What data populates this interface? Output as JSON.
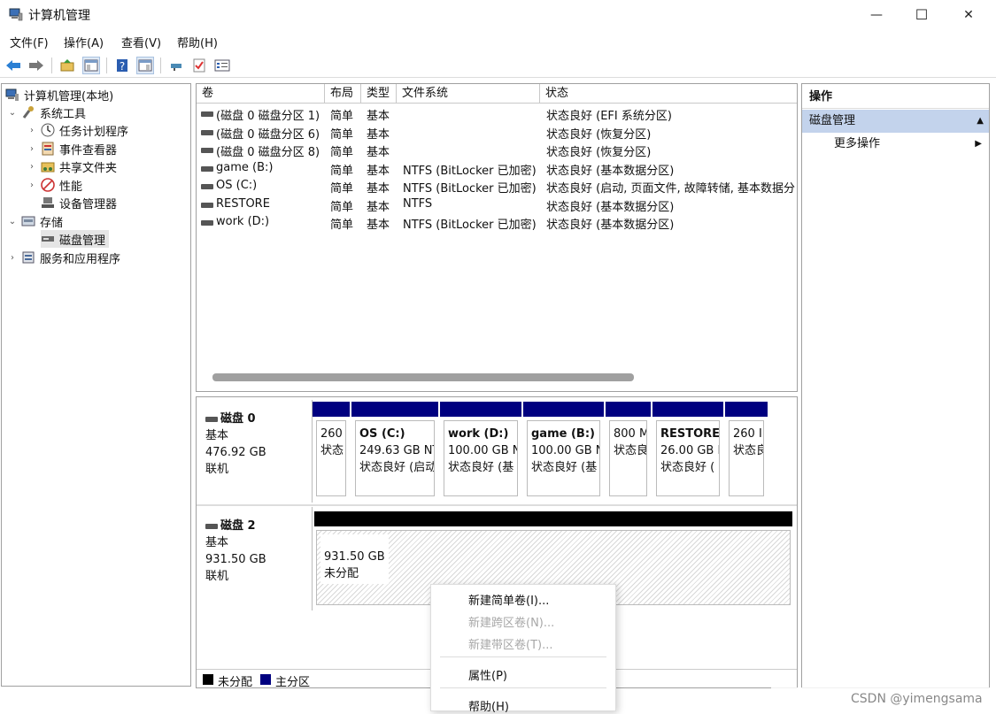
{
  "window": {
    "title": "计算机管理",
    "minimize_glyph": "—",
    "maximize_glyph": "☐",
    "close_glyph": "✕"
  },
  "menu": [
    "文件(F)",
    "操作(A)",
    "查看(V)",
    "帮助(H)"
  ],
  "tree": {
    "root": "计算机管理(本地)",
    "system_tools": "系统工具",
    "task_scheduler": "任务计划程序",
    "event_viewer": "事件查看器",
    "shared_folders": "共享文件夹",
    "performance": "性能",
    "device_manager": "设备管理器",
    "storage": "存储",
    "disk_management": "磁盘管理",
    "services_apps": "服务和应用程序"
  },
  "volume_table": {
    "columns": [
      "卷",
      "布局",
      "类型",
      "文件系统",
      "状态"
    ],
    "rows": [
      {
        "vol": "(磁盘 0 磁盘分区 1)",
        "layout": "简单",
        "type": "基本",
        "fs": "",
        "status": "状态良好 (EFI 系统分区)"
      },
      {
        "vol": "(磁盘 0 磁盘分区 6)",
        "layout": "简单",
        "type": "基本",
        "fs": "",
        "status": "状态良好 (恢复分区)"
      },
      {
        "vol": "(磁盘 0 磁盘分区 8)",
        "layout": "简单",
        "type": "基本",
        "fs": "",
        "status": "状态良好 (恢复分区)"
      },
      {
        "vol": "game (B:)",
        "layout": "简单",
        "type": "基本",
        "fs": "NTFS (BitLocker 已加密)",
        "status": "状态良好 (基本数据分区)"
      },
      {
        "vol": "OS (C:)",
        "layout": "简单",
        "type": "基本",
        "fs": "NTFS (BitLocker 已加密)",
        "status": "状态良好 (启动, 页面文件, 故障转储, 基本数据分"
      },
      {
        "vol": "RESTORE",
        "layout": "简单",
        "type": "基本",
        "fs": "NTFS",
        "status": "状态良好 (基本数据分区)"
      },
      {
        "vol": "work (D:)",
        "layout": "简单",
        "type": "基本",
        "fs": "NTFS (BitLocker 已加密)",
        "status": "状态良好 (基本数据分区)"
      }
    ]
  },
  "disks": [
    {
      "name": "磁盘 0",
      "type": "基本",
      "size": "476.92 GB",
      "state": "联机",
      "partitions": [
        {
          "label": "",
          "size": "260",
          "status": "状态"
        },
        {
          "label": "OS (C:)",
          "size": "249.63 GB NT",
          "status": "状态良好 (启动"
        },
        {
          "label": "work (D:)",
          "size": "100.00 GB N",
          "status": "状态良好 (基"
        },
        {
          "label": "game (B:)",
          "size": "100.00 GB N",
          "status": "状态良好 (基"
        },
        {
          "label": "",
          "size": "800 M",
          "status": "状态良"
        },
        {
          "label": "RESTORE",
          "size": "26.00 GB I",
          "status": "状态良好 ("
        },
        {
          "label": "",
          "size": "260 I",
          "status": "状态良"
        }
      ]
    },
    {
      "name": "磁盘 2",
      "type": "基本",
      "size": "931.50 GB",
      "state": "联机",
      "unallocated": {
        "size": "931.50 GB",
        "status": "未分配"
      }
    }
  ],
  "legend": {
    "unallocated": "未分配",
    "primary": "主分区"
  },
  "actions": {
    "header": "操作",
    "section": "磁盘管理",
    "more": "更多操作"
  },
  "context_menu": {
    "new_simple": "新建简单卷(I)...",
    "new_spanned": "新建跨区卷(N)...",
    "new_striped": "新建带区卷(T)...",
    "properties": "属性(P)",
    "help": "帮助(H)"
  },
  "watermark": "CSDN @yimengsama",
  "colors": {
    "primary_partition": "#000080",
    "unallocated": "#000000",
    "selection": "#cce8ff",
    "action_section": "#c3d3ec"
  }
}
